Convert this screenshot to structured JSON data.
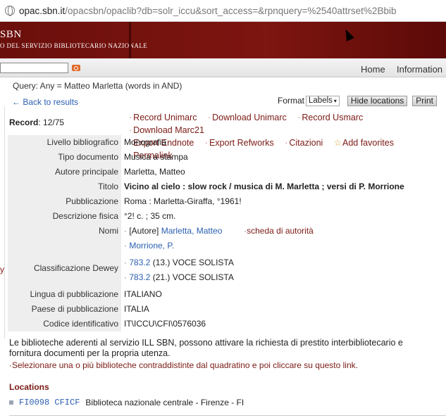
{
  "browser": {
    "url_host": "opac.sbn.it",
    "url_path": "/opacsbn/opaclib?db=solr_iccu&sort_access=&rpnquery=%2540attrset%2Bbib"
  },
  "banner": {
    "logo": "SBN",
    "subtitle": "O DEL SERVIZIO BIBLIOTECARIO NAZIONALE"
  },
  "nav": {
    "search_value": "",
    "home": "Home",
    "information": "Information"
  },
  "query": "Query: Any = Matteo Marletta (words in AND)",
  "back": "← Back to results",
  "format": {
    "label": "Format",
    "selected": "Labels",
    "hide_locations": "Hide locations",
    "print": "Print"
  },
  "record": {
    "label": "Record",
    "value": "12/75"
  },
  "actions": [
    "Record Unimarc",
    "Download Unimarc",
    "Record Usmarc",
    "Download Marc21",
    "Export Endnote",
    "Export Refworks",
    "Citazioni",
    "Add favorites",
    "Permalink"
  ],
  "fields": {
    "livello_label": "Livello bibliografico",
    "livello_value": "Monografia",
    "tipo_label": "Tipo documento",
    "tipo_value": "Musica a stampa",
    "autore_label": "Autore principale",
    "autore_value": "Marletta, Matteo",
    "titolo_label": "Titolo",
    "titolo_value": "Vicino al cielo : slow rock / musica di M. Marletta ; versi di P. Morrione",
    "pubblicazione_label": "Pubblicazione",
    "pubblicazione_value": "Roma : Marletta-Giraffa, °1961!",
    "descrizione_label": "Descrizione fisica",
    "descrizione_value": "°2! c. ; 35 cm.",
    "nomi_label": "Nomi",
    "nomi_role": "[Autore]",
    "nomi_name1": "Marletta, Matteo",
    "nomi_scheda": "scheda di autorità",
    "nomi_name2": "Morrione, P.",
    "dewey_label": "Classificazione Dewey",
    "dewey1_code": "783.2",
    "dewey1_rest": "(13.) VOCE SOLISTA",
    "dewey2_code": "783.2",
    "dewey2_rest": "(21.) VOCE SOLISTA",
    "lingua_label": "Lingua di pubblicazione",
    "lingua_value": "ITALIANO",
    "paese_label": "Paese di pubblicazione",
    "paese_value": "ITALIA",
    "codice_label": "Codice identificativo",
    "codice_value": "IT\\ICCU\\CFI\\0576036"
  },
  "stray_char": "y",
  "ill_text": "Le biblioteche aderenti al servizio ILL SBN, possono attivare la richiesta di prestito interbibliotecario e fornitura documenti per la propria utenza.",
  "ill_instruction": "Selezionare una o più biblioteche contraddistinte dal quadratino e poi cliccare su questo link.",
  "locations": {
    "title": "Locations",
    "code": "FI0098 CFICF",
    "name": "Biblioteca nazionale centrale - Firenze - FI"
  },
  "colors": {
    "banner": "#7d1510",
    "link": "#2a5fb0",
    "accent": "#7a1a14"
  }
}
